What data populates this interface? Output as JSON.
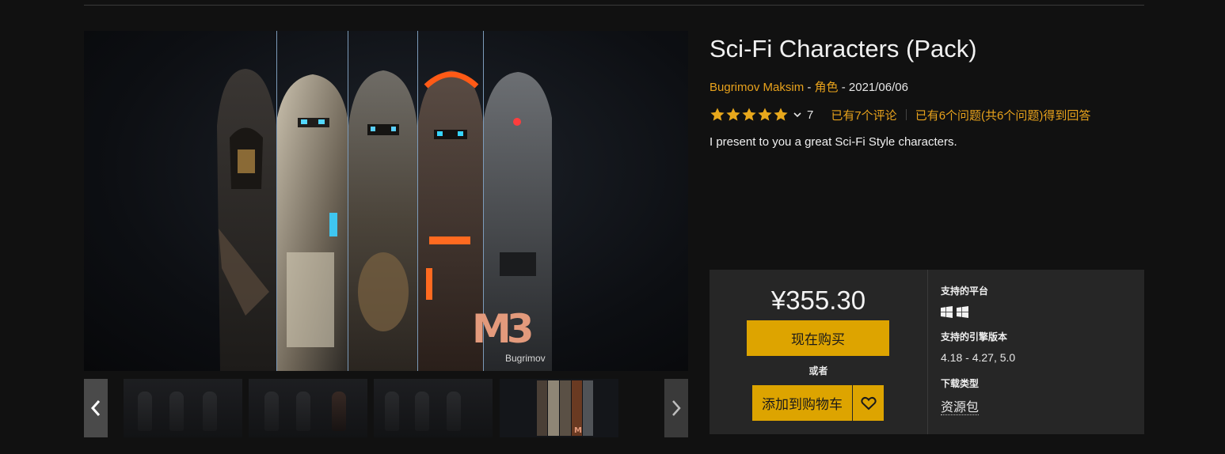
{
  "product": {
    "title": "Sci-Fi Characters (Pack)",
    "author": "Bugrimov Maksim",
    "category": "角色",
    "date": "2021/06/06",
    "meta_sep": " - ",
    "rating_stars": 5,
    "rating_count": "7",
    "reviews_link": "已有7个评论",
    "questions_link": "已有6个问题(共6个问题)得到回答",
    "description": "I present to you a great Sci-Fi Style characters."
  },
  "gallery": {
    "logo_text": "M3",
    "logo_caption": "Bugrimov",
    "thumbnails": [
      "thumb-1",
      "thumb-2",
      "thumb-3",
      "thumb-4"
    ],
    "active_thumbnail": 4
  },
  "purchase": {
    "price": "¥355.30",
    "buy_now_label": "现在购买",
    "or_label": "或者",
    "add_to_cart_label": "添加到购物车"
  },
  "specs": {
    "platforms_label": "支持的平台",
    "platform_icons": [
      "windows-icon",
      "windows-icon"
    ],
    "engine_label": "支持的引擎版本",
    "engine_versions": "4.18 - 4.27, 5.0",
    "download_label": "下载类型",
    "download_type": "资源包"
  },
  "colors": {
    "accent": "#dda400",
    "link": "#e8a21c",
    "background": "#111111",
    "panel": "#262626"
  }
}
